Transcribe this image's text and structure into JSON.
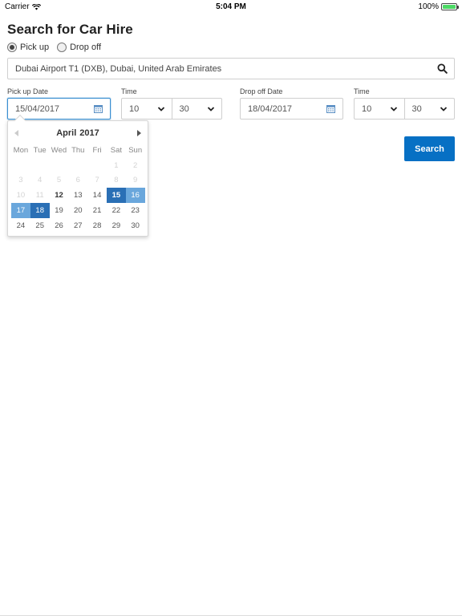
{
  "status_bar": {
    "carrier": "Carrier",
    "time": "5:04 PM",
    "battery": "100%"
  },
  "page_title": "Search for Car Hire",
  "mode": {
    "options": [
      "Pick up",
      "Drop off"
    ],
    "selected": "Pick up"
  },
  "location": {
    "value": "Dubai Airport T1 (DXB), Dubai, United Arab Emirates"
  },
  "pickup": {
    "date_label": "Pick up Date",
    "date": "15/04/2017",
    "time_label": "Time",
    "hour": "10",
    "minute": "30"
  },
  "dropoff": {
    "date_label": "Drop off Date",
    "date": "18/04/2017",
    "time_label": "Time",
    "hour": "10",
    "minute": "30"
  },
  "search_button": "Search",
  "calendar": {
    "month": "April",
    "year": "2017",
    "weekdays": [
      "Mon",
      "Tue",
      "Wed",
      "Thu",
      "Fri",
      "Sat",
      "Sun"
    ],
    "weeks": [
      [
        "",
        "",
        "",
        "",
        "",
        "1",
        "2"
      ],
      [
        "3",
        "4",
        "5",
        "6",
        "7",
        "8",
        "9"
      ],
      [
        "10",
        "11",
        "12",
        "13",
        "14",
        "15",
        "16"
      ],
      [
        "17",
        "18",
        "19",
        "20",
        "21",
        "22",
        "23"
      ],
      [
        "24",
        "25",
        "26",
        "27",
        "28",
        "29",
        "30"
      ]
    ],
    "disabled_days": [
      "1",
      "2",
      "3",
      "4",
      "5",
      "6",
      "7",
      "8",
      "9",
      "10",
      "11"
    ],
    "today": "12",
    "selected_start": "15",
    "selected_end": "18",
    "range_days": [
      "16",
      "17"
    ]
  },
  "colors": {
    "accent": "#0770c4",
    "selected": "#2a6fb5",
    "range": "#6aa7dc",
    "battery": "#4cd964"
  }
}
